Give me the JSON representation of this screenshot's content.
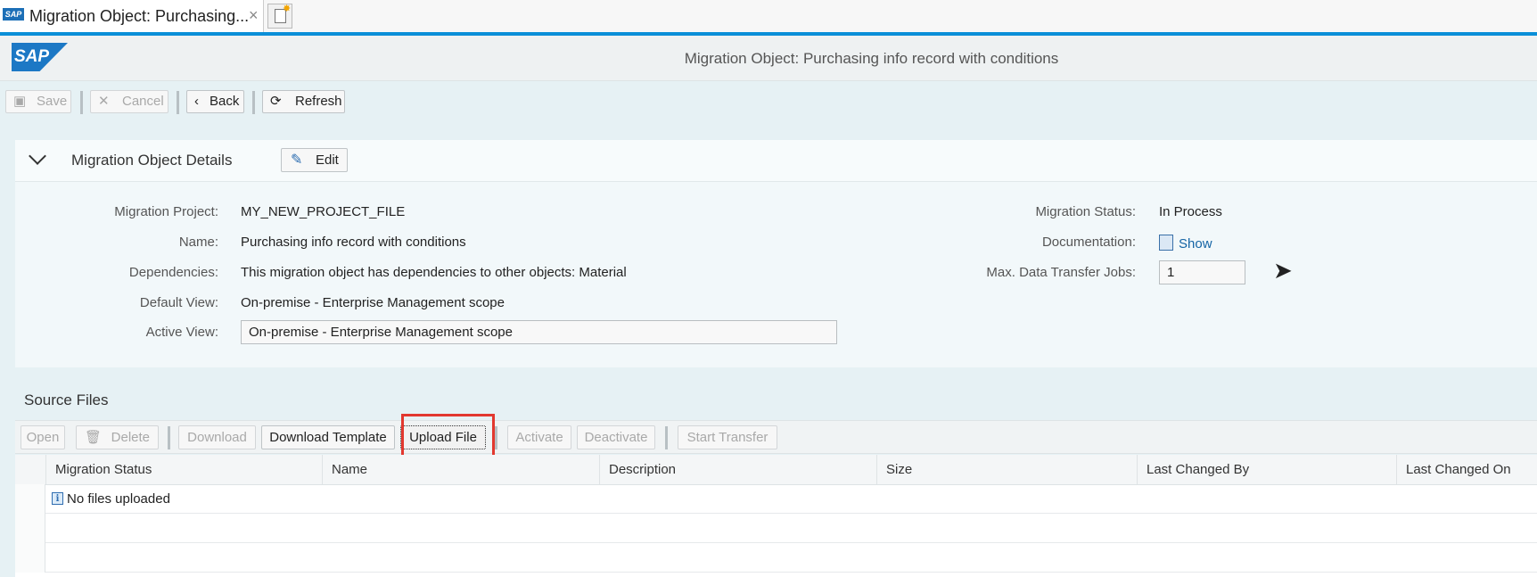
{
  "browser": {
    "tab_title": "Migration Object: Purchasing...",
    "tab_close": "×",
    "favicon_text": "SAP"
  },
  "shell": {
    "logo_text": "SAP",
    "title": "Migration Object: Purchasing info record with conditions"
  },
  "toolbar": {
    "save": "Save",
    "cancel": "Cancel",
    "back": "Back",
    "refresh": "Refresh"
  },
  "details": {
    "title": "Migration Object Details",
    "edit": "Edit",
    "fields_left": [
      {
        "label": "Migration Project:",
        "value": "MY_NEW_PROJECT_FILE"
      },
      {
        "label": "Name:",
        "value": "Purchasing info record with conditions"
      },
      {
        "label": "Dependencies:",
        "value": "This migration object has dependencies to other objects: Material"
      },
      {
        "label": "Default View:",
        "value": "On-premise - Enterprise Management scope"
      },
      {
        "label": "Active View:",
        "value": "On-premise - Enterprise Management scope"
      }
    ],
    "fields_right": [
      {
        "label": "Migration Status:",
        "value": "In Process"
      },
      {
        "label": "Documentation:",
        "value": "Show"
      },
      {
        "label": "Max. Data Transfer Jobs:",
        "value": "1"
      }
    ]
  },
  "source_files": {
    "title": "Source Files",
    "buttons": {
      "open": "Open",
      "delete": "Delete",
      "download": "Download",
      "download_template": "Download Template",
      "upload_file": "Upload File",
      "activate": "Activate",
      "deactivate": "Deactivate",
      "start_transfer": "Start Transfer"
    },
    "columns": [
      "Migration Status",
      "Name",
      "Description",
      "Size",
      "Last Changed By",
      "Last Changed On"
    ],
    "empty_message": "No files uploaded"
  },
  "colors": {
    "accent": "#0a8fd8",
    "sap_blue": "#1c78c5",
    "highlight": "#e2382f",
    "link": "#1464a5"
  }
}
